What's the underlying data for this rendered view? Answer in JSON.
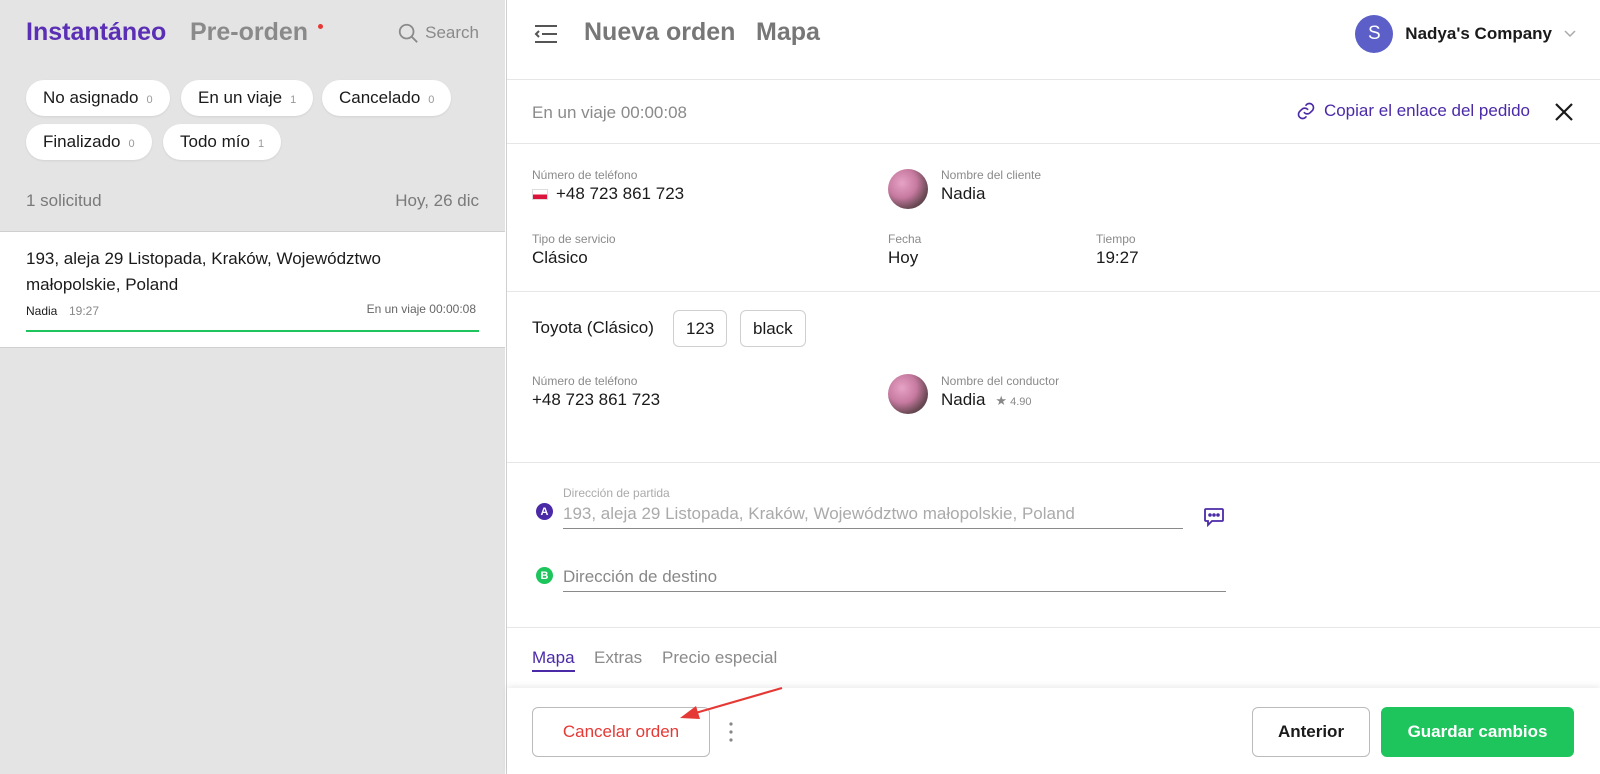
{
  "left": {
    "tabs": {
      "instant": "Instantáneo",
      "preorder": "Pre-orden"
    },
    "search_label": "Search",
    "chips": [
      {
        "label": "No asignado",
        "count": "0"
      },
      {
        "label": "En un viaje",
        "count": "1"
      },
      {
        "label": "Cancelado",
        "count": "0"
      },
      {
        "label": "Finalizado",
        "count": "0"
      },
      {
        "label": "Todo mío",
        "count": "1"
      }
    ],
    "request_count": "1 solicitud",
    "request_date": "Hoy, 26 dic",
    "order": {
      "address": "193, aleja 29 Listopada, Kraków, Województwo małopolskie, Poland",
      "client": "Nadia",
      "time": "19:27",
      "status": "En un viaje 00:00:08"
    }
  },
  "header": {
    "title_new": "Nueva orden",
    "title_map": "Mapa",
    "company_initial": "S",
    "company_name": "Nadya's Company"
  },
  "trip": {
    "status": "En un viaje 00:00:08",
    "copy_link_label": "Copiar el enlace del pedido"
  },
  "client": {
    "phone_label": "Número de teléfono",
    "phone": "+48 723 861 723",
    "name_label": "Nombre del cliente",
    "name": "Nadia",
    "service_label": "Tipo de servicio",
    "service": "Clásico",
    "date_label": "Fecha",
    "date": "Hoy",
    "time_label": "Tiempo",
    "time": "19:27"
  },
  "vehicle": {
    "car": "Toyota (Clásico)",
    "plate": "123",
    "color": "black",
    "phone_label": "Número de teléfono",
    "phone": "+48 723 861 723",
    "driver_label": "Nombre del conductor",
    "driver": "Nadia",
    "rating": "4.90"
  },
  "addresses": {
    "pickup_label": "Dirección de partida",
    "pickup_value": "193, aleja 29 Listopada, Kraków, Województwo małopolskie, Poland",
    "destination_placeholder": "Dirección de destino",
    "point_a": "A",
    "point_b": "B"
  },
  "tabs": [
    "Mapa",
    "Extras",
    "Precio especial"
  ],
  "footer": {
    "cancel_label": "Cancelar orden",
    "prev_label": "Anterior",
    "save_label": "Guardar cambios"
  },
  "colors": {
    "accent": "#4b2aa8",
    "success": "#1ec55c",
    "danger": "#e53935"
  }
}
